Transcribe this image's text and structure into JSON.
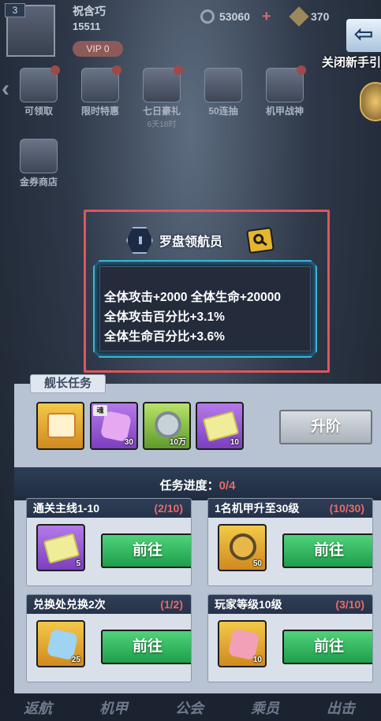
{
  "hud": {
    "level": "3",
    "player_name": "祝含巧",
    "power": "15511",
    "vip": "VIP 0",
    "coins": "53060",
    "gems": "370",
    "close_guide": "关闭新手引"
  },
  "menu": {
    "row1": [
      {
        "label": "可领取",
        "sub": ""
      },
      {
        "label": "限时特惠",
        "sub": ""
      },
      {
        "label": "七日豪礼",
        "sub": "6天18时"
      },
      {
        "label": "50连抽",
        "sub": ""
      },
      {
        "label": "机甲战神",
        "sub": ""
      }
    ],
    "row2": [
      {
        "label": "金券商店",
        "sub": ""
      }
    ]
  },
  "card": {
    "title": "罗盘领航员",
    "stats": [
      "全体攻击+2000  全体生命+20000",
      "全体攻击百分比+3.1%",
      "全体生命百分比+3.6%"
    ]
  },
  "captain": {
    "tab": "舰长任务",
    "rewards": [
      {
        "type": "gift",
        "color": "gold",
        "qty": "",
        "tag": ""
      },
      {
        "type": "puzzle",
        "color": "purple",
        "qty": "30",
        "tag": "魂"
      },
      {
        "type": "coin",
        "color": "green",
        "qty": "10万",
        "tag": ""
      },
      {
        "type": "ticket",
        "color": "purple",
        "qty": "10",
        "tag": ""
      }
    ],
    "upgrade_label": "升阶",
    "progress_label": "任务进度：",
    "progress_current": "0",
    "progress_total": "/4"
  },
  "tasks": [
    {
      "name": "通关主线1-10",
      "progress": "(2/10)",
      "qty": "5",
      "icon": "ticket",
      "color": "purple",
      "button": "前往"
    },
    {
      "name": "1名机甲升至30级",
      "progress": "(10/30)",
      "qty": "50",
      "icon": "coin",
      "color": "gold",
      "button": "前往"
    },
    {
      "name": "兑换处兑换2次",
      "progress": "(1/2)",
      "qty": "25",
      "icon": "puzzle",
      "color": "gold",
      "button": "前往"
    },
    {
      "name": "玩家等级10级",
      "progress": "(3/10)",
      "qty": "10",
      "icon": "puzzle",
      "color": "gold",
      "button": "前往"
    }
  ],
  "nav": [
    "返航",
    "机甲",
    "公会",
    "乘员",
    "出击"
  ]
}
